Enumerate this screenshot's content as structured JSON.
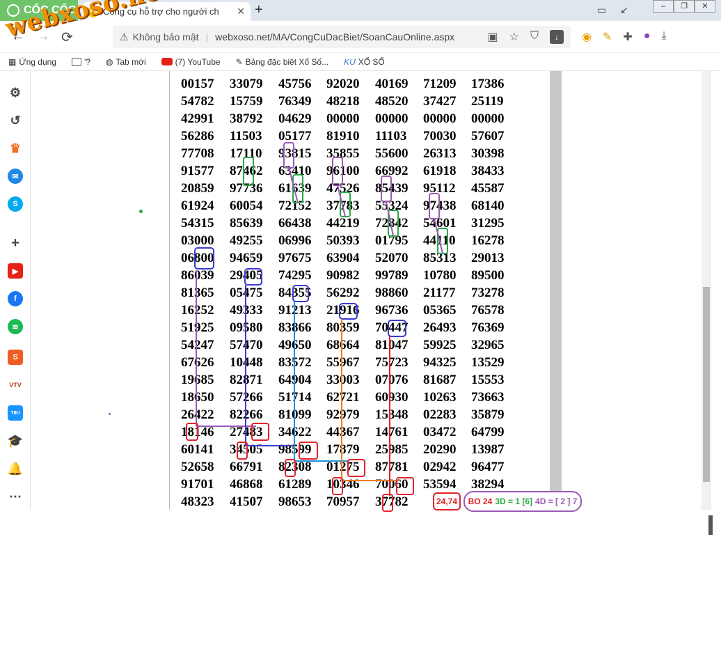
{
  "browser": {
    "brand": "CỐC CỐC",
    "tab": {
      "favicon": "XS",
      "title": "Công cụ hỗ trợ cho người ch",
      "close": "✕"
    },
    "new_tab": "+",
    "address": {
      "security_label": "Không bảo mật",
      "url": "webxoso.net/MA/CongCuDacBiet/SoanCauOnline.aspx"
    },
    "bookmarks": [
      {
        "label": "Ứng dụng"
      },
      {
        "label": "'?"
      },
      {
        "label": "Tab mới"
      },
      {
        "label": "(7) YouTube"
      },
      {
        "label": "Bảng đặc biệt Xổ Số..."
      },
      {
        "label": "XỔ SỐ"
      }
    ]
  },
  "watermark": "webxoso.net",
  "table": {
    "rows": [
      [
        "00157",
        "33079",
        "45756",
        "92020",
        "40169",
        "71209",
        "17386"
      ],
      [
        "54782",
        "15759",
        "76349",
        "48218",
        "48520",
        "37427",
        "25119"
      ],
      [
        "42991",
        "38792",
        "04629",
        "00000",
        "00000",
        "00000",
        "00000"
      ],
      [
        "56286",
        "11503",
        "05177",
        "81910",
        "11103",
        "70030",
        "57607"
      ],
      [
        "77708",
        "17110",
        "93815",
        "35855",
        "55600",
        "26313",
        "30398"
      ],
      [
        "91577",
        "87462",
        "63410",
        "96100",
        "66992",
        "61918",
        "38433"
      ],
      [
        "20859",
        "97736",
        "61639",
        "47526",
        "85439",
        "95112",
        "45587"
      ],
      [
        "61924",
        "60054",
        "72152",
        "37783",
        "55324",
        "97438",
        "68140"
      ],
      [
        "54315",
        "85639",
        "66438",
        "44219",
        "72842",
        "54601",
        "31295"
      ],
      [
        "03000",
        "49255",
        "06996",
        "50393",
        "01795",
        "44110",
        "16278"
      ],
      [
        "06800",
        "94659",
        "97675",
        "63904",
        "52070",
        "85313",
        "29013"
      ],
      [
        "86039",
        "29405",
        "74295",
        "90982",
        "99789",
        "10780",
        "89500"
      ],
      [
        "81365",
        "05475",
        "84355",
        "56292",
        "98860",
        "21177",
        "73278"
      ],
      [
        "16252",
        "49333",
        "91213",
        "21916",
        "96736",
        "05365",
        "76578"
      ],
      [
        "51925",
        "09580",
        "83866",
        "80359",
        "70447",
        "26493",
        "76369"
      ],
      [
        "54247",
        "57470",
        "49650",
        "68664",
        "81047",
        "59925",
        "32965"
      ],
      [
        "67626",
        "10448",
        "83572",
        "55967",
        "75723",
        "94325",
        "13529"
      ],
      [
        "19685",
        "82871",
        "64904",
        "33003",
        "07076",
        "81687",
        "15553"
      ],
      [
        "18650",
        "57266",
        "51714",
        "62721",
        "60930",
        "10263",
        "73663"
      ],
      [
        "26422",
        "82266",
        "81099",
        "92979",
        "15348",
        "02283",
        "35879"
      ],
      [
        "18146",
        "27483",
        "34622",
        "44367",
        "14761",
        "03472",
        "64799"
      ],
      [
        "60141",
        "34505",
        "98599",
        "17879",
        "25985",
        "20290",
        "13987"
      ],
      [
        "52658",
        "66791",
        "82308",
        "01275",
        "87781",
        "02942",
        "96477"
      ],
      [
        "91701",
        "46868",
        "61289",
        "10346",
        "70060",
        "53594",
        "38294"
      ],
      [
        "48323",
        "41507",
        "98653",
        "70957",
        "37782",
        "",
        ""
      ]
    ]
  },
  "annotations": {
    "badge_left": "24,74",
    "badge_right": {
      "bo": "BO 24",
      "d3": "3D = 1 [6]",
      "d4": "4D = [ 2 ] 7"
    }
  },
  "colors": {
    "red": "#e3222a",
    "green": "#2aa845",
    "purple": "#9b59b6",
    "blue": "#3a3ad0",
    "lightblue": "#1e90d8",
    "orange": "#f07d1a"
  }
}
